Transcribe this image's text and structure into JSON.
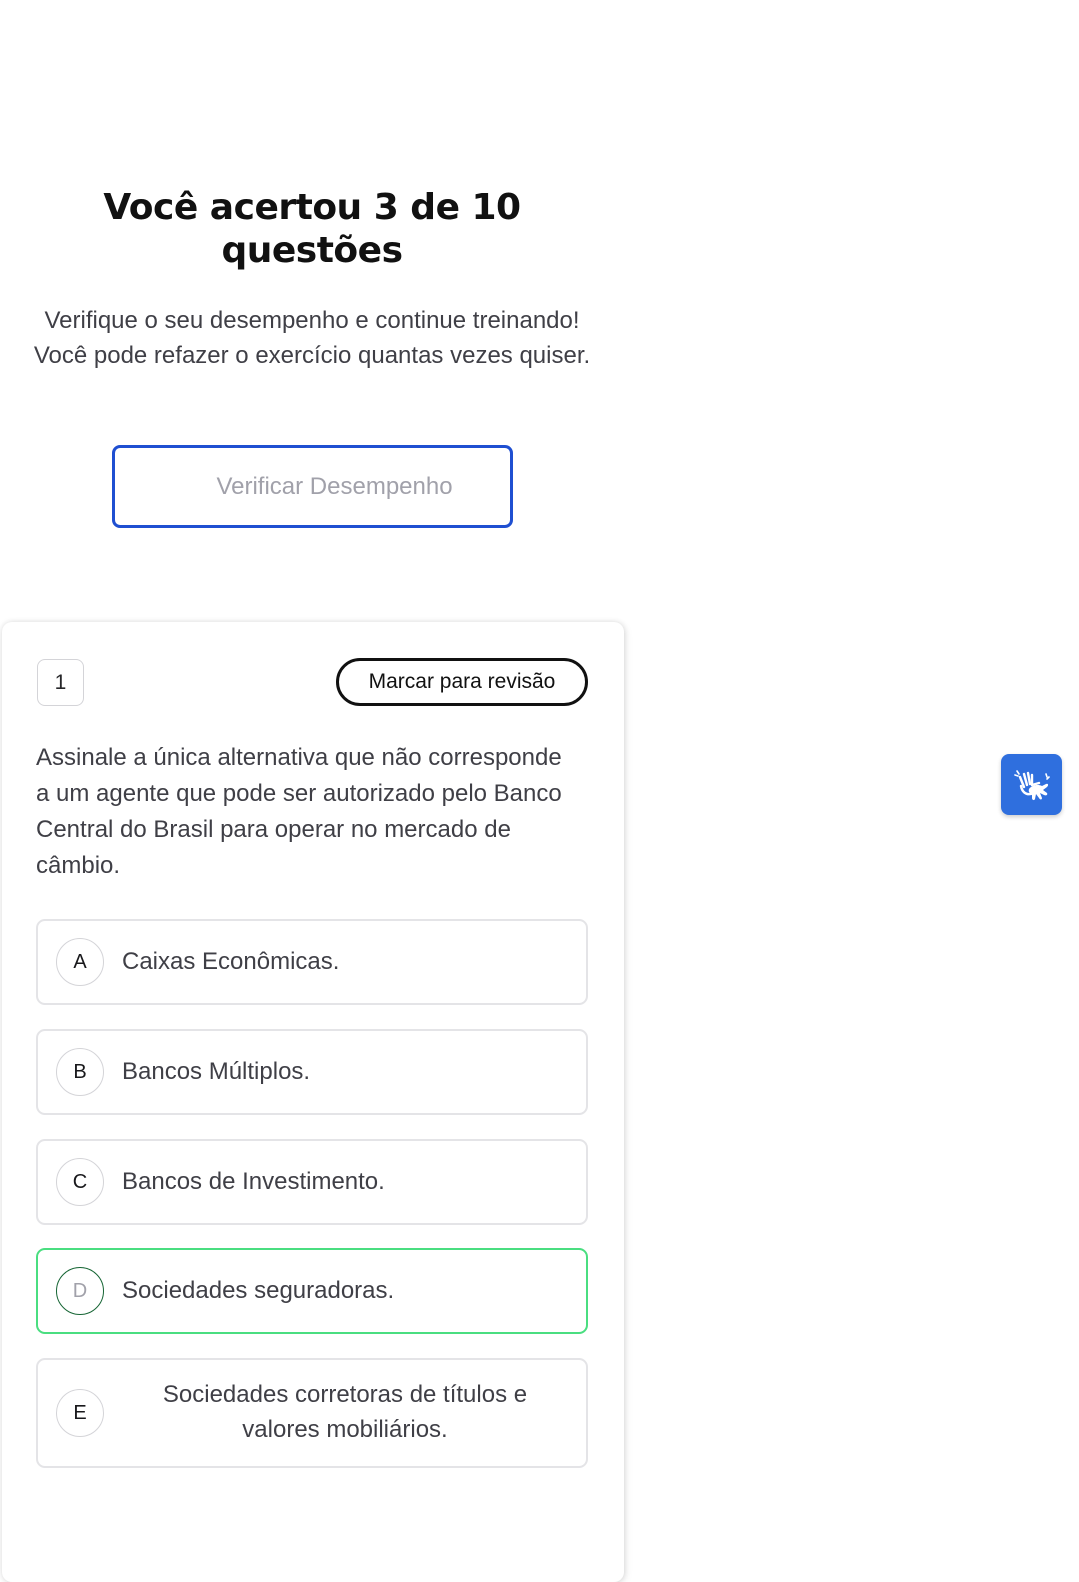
{
  "result": {
    "title": "Você acertou 3 de 10 questões",
    "subtitle": "Verifique o seu desempenho e continue treinando! Você pode refazer o exercício quantas vezes quiser.",
    "verify_button_label": "Verificar Desempenho"
  },
  "question": {
    "number": "1",
    "review_button_label": "Marcar para revisão",
    "text": "Assinale a única alternativa que não corresponde a um agente que pode ser autorizado pelo Banco Central do Brasil para operar no mercado de câmbio.",
    "selected": "D",
    "options": [
      {
        "letter": "A",
        "text": "Caixas Econômicas."
      },
      {
        "letter": "B",
        "text": "Bancos Múltiplos."
      },
      {
        "letter": "C",
        "text": "Bancos de Investimento."
      },
      {
        "letter": "D",
        "text": "Sociedades seguradoras."
      },
      {
        "letter": "E",
        "text": "Sociedades corretoras de títulos e valores mobiliários."
      }
    ]
  },
  "accessibility": {
    "icon": "sign-language-hands-icon",
    "color": "#2f6fde"
  },
  "colors": {
    "accent_blue": "#1f4fd1",
    "selected_green": "#4ade80",
    "selected_letter_ring": "#166534"
  }
}
